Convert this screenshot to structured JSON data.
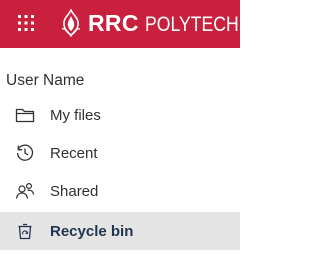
{
  "header": {
    "brand_color": "#c8203d",
    "app_launcher_icon": "waffle-icon",
    "logo": {
      "name": "RRC",
      "sub": "POLYTECH",
      "emblem_icon": "flame-emblem-icon"
    }
  },
  "user": {
    "name": "User Name"
  },
  "nav": {
    "items": [
      {
        "label": "My files",
        "icon": "folder-icon"
      },
      {
        "label": "Recent",
        "icon": "history-clock-icon"
      },
      {
        "label": "Shared",
        "icon": "people-icon"
      },
      {
        "label": "Recycle bin",
        "icon": "recycle-bin-icon",
        "active": true
      }
    ]
  },
  "colors": {
    "text": "#323130",
    "active_text": "#1f3550",
    "active_bg": "#e4e4e4"
  }
}
